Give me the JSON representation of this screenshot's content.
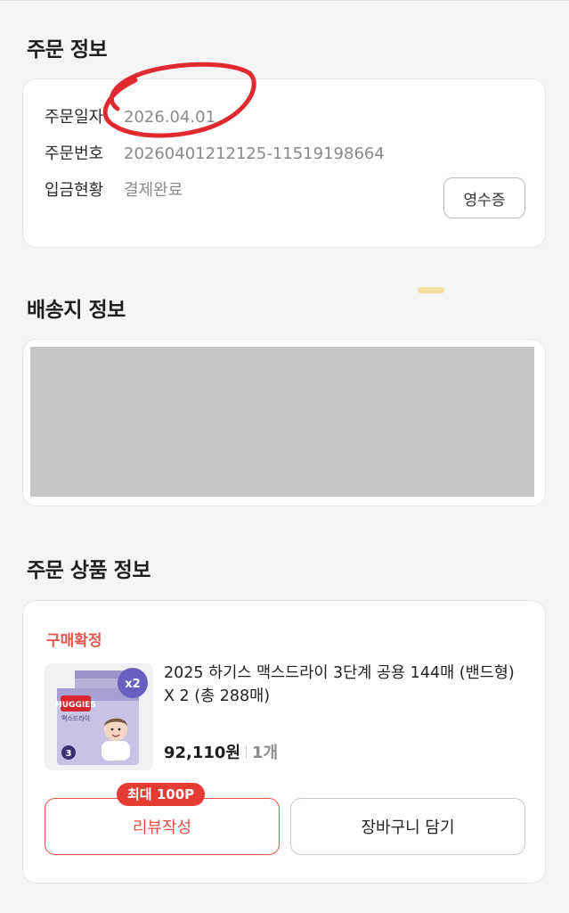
{
  "order_info": {
    "title": "주문 정보",
    "rows": [
      {
        "label": "주문일자",
        "value": "2026.04.01"
      },
      {
        "label": "주문번호",
        "value": "20260401212125-11519198664"
      },
      {
        "label": "입금현황",
        "value": "결제완료"
      }
    ],
    "receipt_button": "영수증"
  },
  "shipping_info": {
    "title": "배송지 정보"
  },
  "order_products": {
    "title": "주문 상품 정보",
    "status": "구매확정",
    "product": {
      "name": "2025 하기스 맥스드라이 3단계 공용 144매 (밴드형) X 2 (총 288매)",
      "price": "92,110원",
      "quantity": "1개",
      "thumbnail": {
        "badge": "x2",
        "brand_text": "HUGGIES",
        "line_text": "맥스드라이",
        "step": "3"
      }
    },
    "review_badge": "최대 100P",
    "review_button": "리뷰작성",
    "cart_button": "장바구니 담기"
  },
  "colors": {
    "accent_red": "#e25148",
    "annotation_red": "#e02a2f",
    "redaction_gray": "#c6c5c8"
  }
}
